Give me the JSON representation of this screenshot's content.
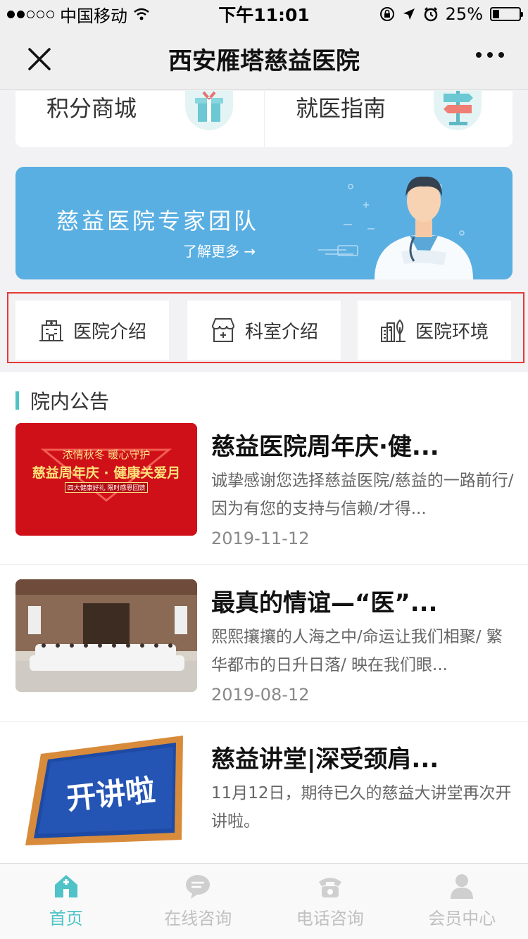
{
  "status_bar": {
    "carrier": "中国移动",
    "time": "下午11:01",
    "battery": "25%",
    "battery_level": 0.25
  },
  "titlebar": {
    "title": "西安雁塔慈益医院",
    "close_icon": "close-icon",
    "more_icon": "more-icon"
  },
  "quick_links": [
    {
      "label": "积分商城",
      "icon": "gift-icon"
    },
    {
      "label": "就医指南",
      "icon": "signpost-icon"
    }
  ],
  "banner": {
    "title": "慈益医院专家团队",
    "more": "了解更多 →"
  },
  "nav": [
    {
      "label": "医院介绍",
      "icon": "hospital-icon"
    },
    {
      "label": "科室介绍",
      "icon": "department-icon"
    },
    {
      "label": "医院环境",
      "icon": "environment-icon"
    }
  ],
  "notices": {
    "section_title": "院内公告",
    "items": [
      {
        "title": "慈益医院周年庆·健...",
        "desc": "诚挚感谢您选择慈益医院/慈益的一路前行/因为有您的支持与信赖/才得...",
        "date": "2019-11-12",
        "thumb": {
          "line1": "浓情秋冬   暖心守护",
          "line2": "慈益周年庆 · 健康关爱月",
          "line3": "四大健康好礼   限时感恩回馈"
        }
      },
      {
        "title": "最真的情谊—“医”...",
        "desc": "熙熙攘攘的人海之中/命运让我们相聚/ 繁华都市的日升日落/ 映在我们眼...",
        "date": "2019-08-12"
      },
      {
        "title": "慈益讲堂|深受颈肩...",
        "desc": "11月12日，期待已久的慈益大讲堂再次开讲啦。",
        "date": "",
        "thumb": {
          "text": "开讲啦"
        }
      }
    ]
  },
  "tabs": [
    {
      "label": "首页",
      "icon": "home-icon",
      "active": true
    },
    {
      "label": "在线咨询",
      "icon": "chat-icon",
      "active": false
    },
    {
      "label": "电话咨询",
      "icon": "phone-icon",
      "active": false
    },
    {
      "label": "会员中心",
      "icon": "user-icon",
      "active": false
    }
  ],
  "colors": {
    "accent": "#4fc3c7",
    "banner": "#5aafe2",
    "highlight_border": "#e53935"
  }
}
